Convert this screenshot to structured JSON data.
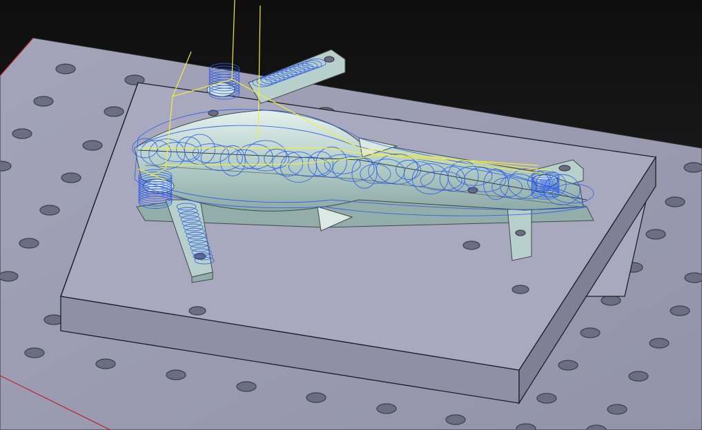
{
  "viewport": {
    "name": "cam-3d-viewport",
    "background_color": "#1b1b1b",
    "table_color": "#9c9db3",
    "fixture_top_color": "#a7a8be",
    "fixture_side_color": "#8e8fa4",
    "part_color": "#b8d0cc",
    "toolpath_color": "#2b5de8",
    "rapid_move_color": "#f2ee3a",
    "table_edge_color": "#c0202a"
  },
  "scene": {
    "objects": [
      "machine-table",
      "fixture-plate",
      "workpiece",
      "toolpath",
      "rapid-moves"
    ]
  }
}
